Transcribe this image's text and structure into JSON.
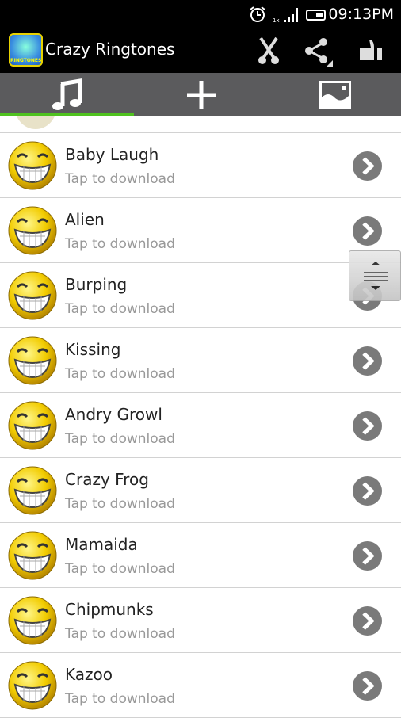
{
  "status": {
    "time": "09:13PM",
    "sim": "1x"
  },
  "app": {
    "title": "Crazy Ringtones",
    "logo_text": "RINGTONES"
  },
  "actions": [
    {
      "icon": "scissors-icon"
    },
    {
      "icon": "share-icon"
    },
    {
      "icon": "thumbs-up-icon"
    }
  ],
  "tabs": [
    {
      "icon": "music-note-icon",
      "selected": true
    },
    {
      "icon": "plus-icon"
    },
    {
      "icon": "image-icon"
    }
  ],
  "colors": {
    "accent": "#4fc21f",
    "tabbar": "#5b5b5d"
  },
  "list": {
    "items": [
      {
        "name": "Baby Laugh",
        "sub": "Tap to download"
      },
      {
        "name": "Alien",
        "sub": "Tap to download"
      },
      {
        "name": "Burping",
        "sub": "Tap to download"
      },
      {
        "name": "Kissing",
        "sub": "Tap to download"
      },
      {
        "name": "Andry Growl",
        "sub": "Tap to download"
      },
      {
        "name": "Crazy Frog",
        "sub": "Tap to download"
      },
      {
        "name": "Mamaida",
        "sub": "Tap to download"
      },
      {
        "name": "Chipmunks",
        "sub": "Tap to download"
      },
      {
        "name": "Kazoo",
        "sub": "Tap to download"
      }
    ]
  }
}
